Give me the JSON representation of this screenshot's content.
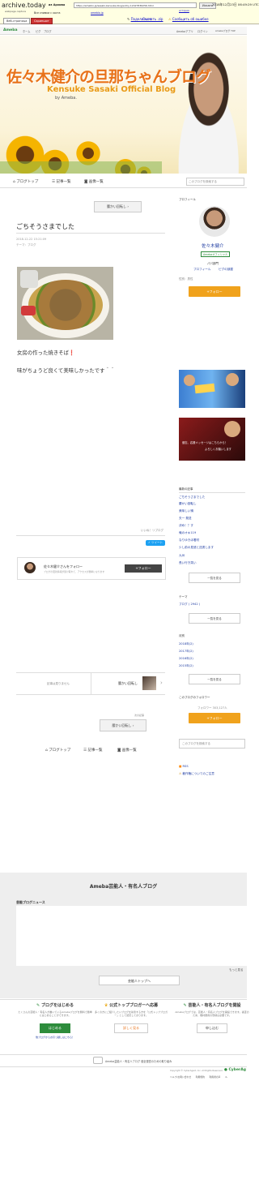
{
  "archive": {
    "site": "archive.today",
    "subtitle": "webpage capture",
    "saved_from_label": "из Архива",
    "url": "https://ameblo.jp/sasaki-kensuke-blog/entry-12427836256.html",
    "search_label": "Искать",
    "history_label": "история",
    "date": "2018年12月23日 06:49:29 UTC",
    "all_shots": "Все снимки с хоста",
    "ameblo": "ameblo.jp",
    "tab_web": "Веб-страница",
    "tab_shot": "Скриншот",
    "share": "Поделиться",
    "download": "Скачать .zip",
    "report": "Сообщить об ошибке"
  },
  "ameba_header": {
    "brand": "Ameba",
    "crumb_home": "ホーム",
    "crumb_pigg": "ピグ",
    "crumb_blog": "ブログ",
    "app": "Amebaアプリ",
    "login": "ログイン",
    "help": "Amebaブログ TOP"
  },
  "banner": {
    "title": "佐々木健介の旦那ちゃんブログ",
    "subtitle": "Kensuke Sasaki Official Blog",
    "by": "by Ameba."
  },
  "nav": {
    "top": "ブログトップ",
    "list": "記事一覧",
    "images": "画像一覧",
    "search_placeholder": "このブログを検索する"
  },
  "entry": {
    "prev": "腰かい回転し",
    "title": "ごちそうさまでした",
    "date": "2018-12-22 15:21:09",
    "theme": "テーマ：ブログ",
    "text1": "女房の作った焼きそば❗",
    "text2": "味がちょうど良くて美味しかったです＾＾",
    "likes": "いいね！リブログ",
    "tweet": "ツイート",
    "follow_name": "佐々木健介さんをフォロー",
    "follow_sub": "ブログの更新情報が受け取れて、アクセスが簡単になります",
    "follow_btn": "+フォロー",
    "no_next": "記事は見りません",
    "prev_label": "腰かい回転し",
    "prev_box": "腰かい回転し",
    "more": "次の記事"
  },
  "bottom_nav": {
    "top": "ブログトップ",
    "list": "記事一覧",
    "images": "画像一覧"
  },
  "sidebar": {
    "profile": "プロフィール",
    "name": "佐々木健介",
    "badge": "Amebaオフィシャル",
    "genre": "パパ部門",
    "profile_link": "プロフィール",
    "pigg_link": "ピグの部屋",
    "gender": "性別：男性",
    "follow": "+フォロー",
    "ad2_line1": "健志、応援メッセージはこちらから！",
    "ad2_line2": "よろしくお願いします",
    "recent_title": "最新の記事",
    "recent": [
      "ごちそうさまでした",
      "腰かい回転し",
      "美味しい鍋",
      "夫一 発送",
      "決め！？す",
      "俺のオキ119",
      "なりゆきほ着材",
      "少し前の見遣と送書します",
      "九州",
      "長い行き笑い"
    ],
    "more1": "一覧を見る",
    "theme_title": "テーマ",
    "theme_item": "ブログ ( 2942 )",
    "more2": "一覧を見る",
    "month_title": "月別",
    "months": [
      "2018年(2)",
      "2017年(2)",
      "2016年(2)",
      "2015年(2)"
    ],
    "more3": "一覧を見る",
    "followers_title": "このブログのフォロワー",
    "followers": "フォロワー 303,127人",
    "follow2": "+フォロー",
    "search2": "このブログを検索する",
    "rss": "RSS",
    "report": "著作権についてのご注意"
  },
  "footer": {
    "section": "Ameba芸能人・有名人ブログ",
    "news": "芸能ブログニュース",
    "more": "もっと見る",
    "top_btn": "芸能人トップへ"
  },
  "promo": [
    {
      "title": "ブログをはじめる",
      "desc": "たくさんの芸能人・有名人が書いているAmebaブログを無料で簡単にはじめることができます。",
      "btn": "はじめる",
      "note": "他ブログからお引っ越しはこちら！"
    },
    {
      "title": "公式トップブロガーへ応募",
      "desc": "多くの方にご紹介したいブログを執筆する方を「公式トップブロガー」として認定しております。",
      "btn": "詳しく見る"
    },
    {
      "title": "芸能人・有名人ブログを開設",
      "desc": "Amebaブログでは、芸能人・有名人ブログを開設できます。審査のため、機材費用の登録は必要です。",
      "btn": "申し込む"
    }
  ],
  "legal": {
    "line": "Ameba芸能人・有名人ブログ 健全運営のための取り組み",
    "copyright": "Copyright © CyberAgent, Inc. All Rights Reserved.",
    "links": "ヘルプ/お問い合わせ　　利用規約　　利用者の声　　ル"
  }
}
